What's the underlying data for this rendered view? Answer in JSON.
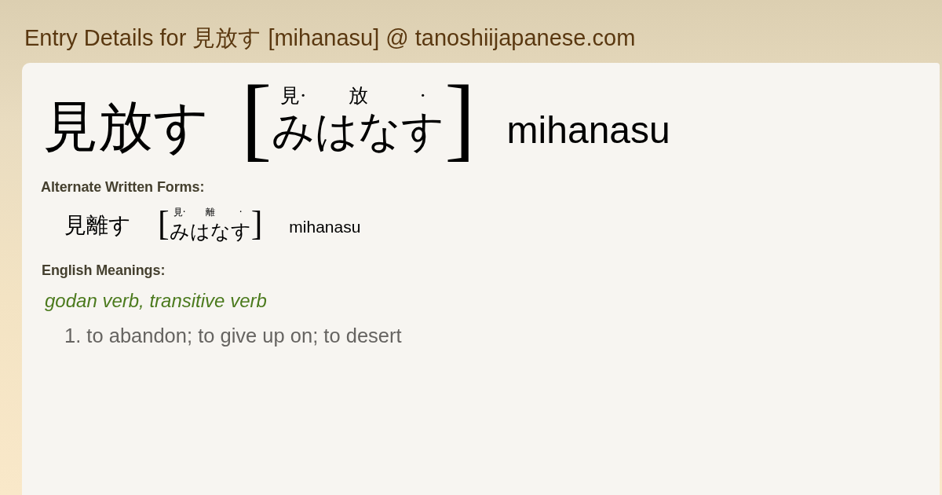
{
  "page_title": "Entry Details for 見放す [mihanasu] @ tanoshiijapanese.com",
  "entry": {
    "word": "見放す",
    "reading": {
      "bracket_open": "[",
      "segments": [
        {
          "annotation": "見·",
          "kana": "み"
        },
        {
          "annotation": "放",
          "kana": "はな"
        },
        {
          "annotation": "·",
          "kana": "す"
        }
      ],
      "bracket_close": "]"
    },
    "romaji": "mihanasu"
  },
  "alternate_forms": {
    "heading": "Alternate Written Forms:",
    "forms": [
      {
        "word": "見離す",
        "reading": {
          "bracket_open": "[",
          "segments": [
            {
              "annotation": "見·",
              "kana": "み"
            },
            {
              "annotation": "離",
              "kana": "はな"
            },
            {
              "annotation": "·",
              "kana": "す"
            }
          ],
          "bracket_close": "]"
        },
        "romaji": "mihanasu"
      }
    ]
  },
  "meanings": {
    "heading": "English Meanings:",
    "groups": [
      {
        "part_of_speech": "godan verb, transitive verb",
        "senses": [
          "1. to abandon; to give up on; to desert"
        ]
      }
    ]
  }
}
